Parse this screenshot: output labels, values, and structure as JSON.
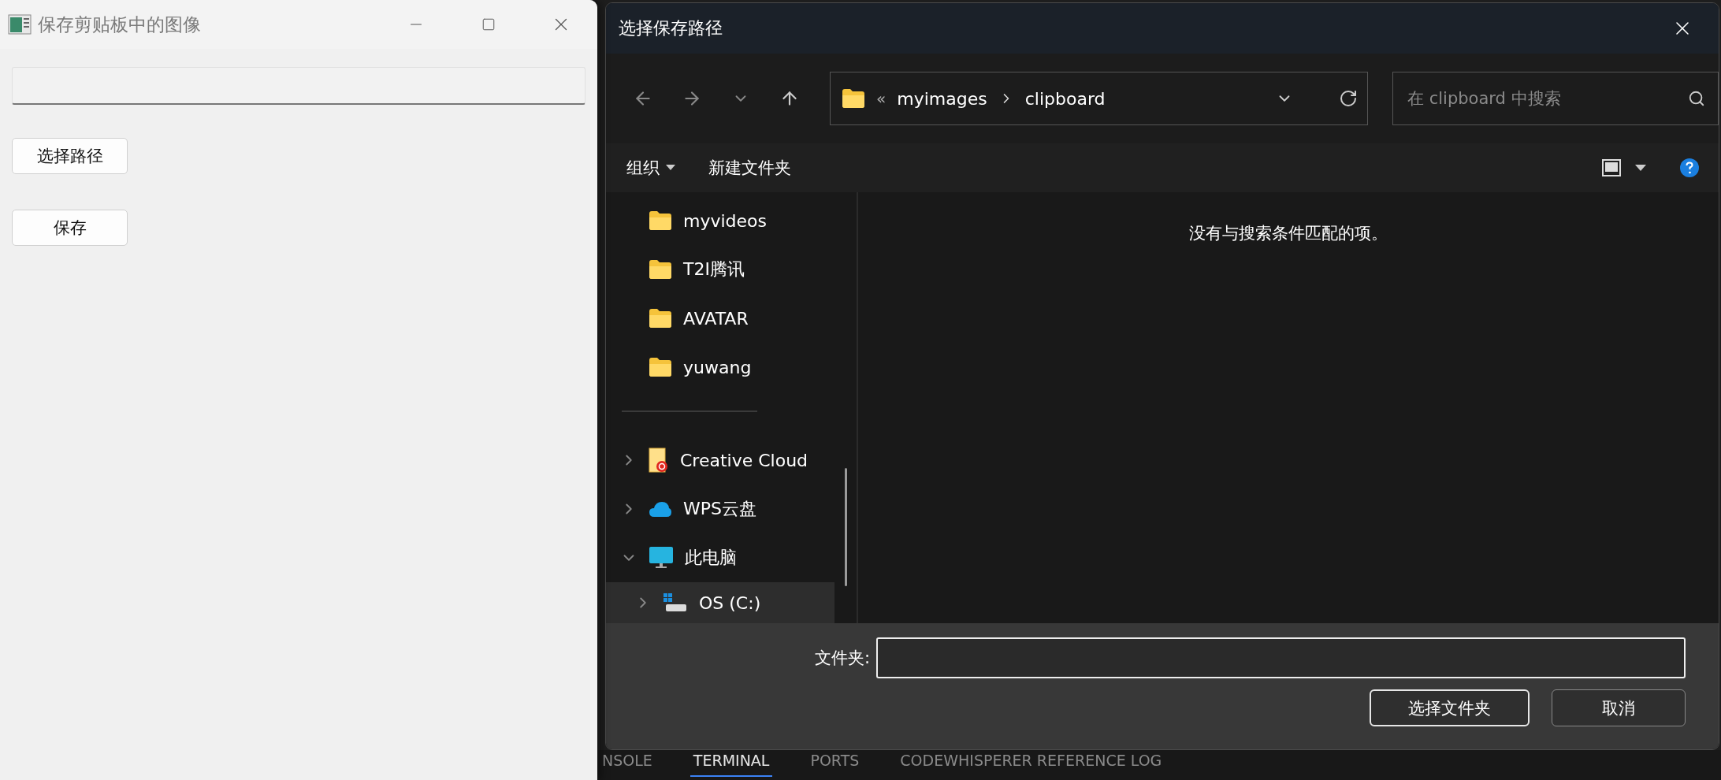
{
  "main_window": {
    "title": "保存剪贴板中的图像",
    "buttons": [
      {
        "label": "选择路径"
      },
      {
        "label": "保存"
      }
    ]
  },
  "dialog": {
    "title": "选择保存路径",
    "overflow_marker": "«",
    "breadcrumb": [
      "myimages",
      "clipboard"
    ],
    "search": {
      "placeholder": "在 clipboard 中搜索"
    },
    "toolbar": [
      {
        "label": "组织",
        "kind": "menu"
      },
      {
        "label": "新建文件夹",
        "kind": "button"
      }
    ],
    "nav_groups": [
      {
        "items": [
          {
            "label": "myvideos",
            "kind": "folder",
            "selected": false
          },
          {
            "label": "T2I腾讯",
            "kind": "folder",
            "selected": false
          },
          {
            "label": "AVATAR",
            "kind": "folder",
            "selected": false
          },
          {
            "label": "yuwang",
            "kind": "folder",
            "selected": false
          }
        ]
      },
      {
        "items": [
          {
            "label": "Creative Cloud",
            "kind": "cloud-file",
            "expanded": false,
            "selected": false
          },
          {
            "label": "WPS云盘",
            "kind": "cloud",
            "expanded": false,
            "selected": false
          },
          {
            "label": "此电脑",
            "kind": "computer",
            "expanded": true,
            "selected": false
          },
          {
            "label": "OS (C:)",
            "kind": "drive",
            "expanded": false,
            "selected": true
          }
        ]
      }
    ],
    "empty_message": "没有与搜索条件匹配的项。",
    "folder_field": {
      "label": "文件夹:"
    },
    "buttons": [
      {
        "label": "选择文件夹",
        "kind": "primary"
      },
      {
        "label": "取消",
        "kind": "secondary"
      }
    ]
  },
  "panel_tabs": [
    {
      "label": "NSOLE",
      "selected": false
    },
    {
      "label": "TERMINAL",
      "selected": true
    },
    {
      "label": "PORTS",
      "selected": false
    },
    {
      "label": "CODEWHISPERER REFERENCE LOG",
      "selected": false
    }
  ]
}
